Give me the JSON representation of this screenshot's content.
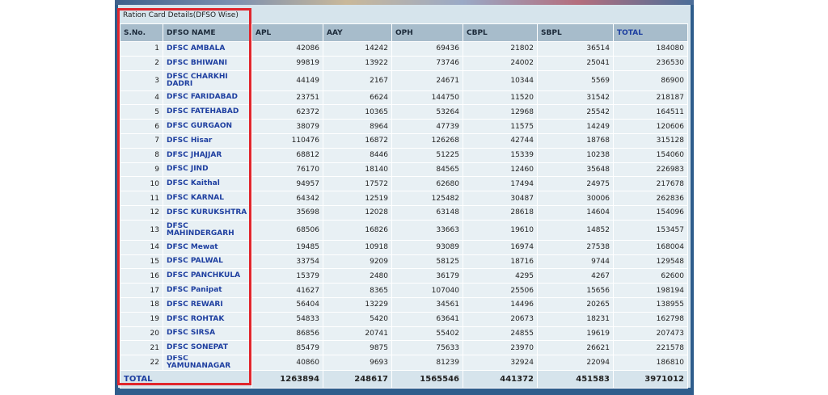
{
  "caption": "Ration Card Details(DFSO Wise)",
  "headers": [
    "S.No.",
    "DFSO NAME",
    "APL",
    "AAY",
    "OPH",
    "CBPL",
    "SBPL",
    "TOTAL"
  ],
  "rows": [
    {
      "sno": "1",
      "name": "DFSC AMBALA",
      "apl": "42086",
      "aay": "14242",
      "oph": "69436",
      "cbpl": "21802",
      "sbpl": "36514",
      "total": "184080"
    },
    {
      "sno": "2",
      "name": "DFSC BHIWANI",
      "apl": "99819",
      "aay": "13922",
      "oph": "73746",
      "cbpl": "24002",
      "sbpl": "25041",
      "total": "236530"
    },
    {
      "sno": "3",
      "name": "DFSC CHARKHI DADRI",
      "apl": "44149",
      "aay": "2167",
      "oph": "24671",
      "cbpl": "10344",
      "sbpl": "5569",
      "total": "86900"
    },
    {
      "sno": "4",
      "name": "DFSC FARIDABAD",
      "apl": "23751",
      "aay": "6624",
      "oph": "144750",
      "cbpl": "11520",
      "sbpl": "31542",
      "total": "218187"
    },
    {
      "sno": "5",
      "name": "DFSC FATEHABAD",
      "apl": "62372",
      "aay": "10365",
      "oph": "53264",
      "cbpl": "12968",
      "sbpl": "25542",
      "total": "164511"
    },
    {
      "sno": "6",
      "name": "DFSC GURGAON",
      "apl": "38079",
      "aay": "8964",
      "oph": "47739",
      "cbpl": "11575",
      "sbpl": "14249",
      "total": "120606"
    },
    {
      "sno": "7",
      "name": "DFSC Hisar",
      "apl": "110476",
      "aay": "16872",
      "oph": "126268",
      "cbpl": "42744",
      "sbpl": "18768",
      "total": "315128"
    },
    {
      "sno": "8",
      "name": "DFSC JHAJJAR",
      "apl": "68812",
      "aay": "8446",
      "oph": "51225",
      "cbpl": "15339",
      "sbpl": "10238",
      "total": "154060"
    },
    {
      "sno": "9",
      "name": "DFSC JIND",
      "apl": "76170",
      "aay": "18140",
      "oph": "84565",
      "cbpl": "12460",
      "sbpl": "35648",
      "total": "226983"
    },
    {
      "sno": "10",
      "name": "DFSC Kaithal",
      "apl": "94957",
      "aay": "17572",
      "oph": "62680",
      "cbpl": "17494",
      "sbpl": "24975",
      "total": "217678"
    },
    {
      "sno": "11",
      "name": "DFSC KARNAL",
      "apl": "64342",
      "aay": "12519",
      "oph": "125482",
      "cbpl": "30487",
      "sbpl": "30006",
      "total": "262836"
    },
    {
      "sno": "12",
      "name": "DFSC KURUKSHTRA",
      "apl": "35698",
      "aay": "12028",
      "oph": "63148",
      "cbpl": "28618",
      "sbpl": "14604",
      "total": "154096"
    },
    {
      "sno": "13",
      "name": "DFSC MAHINDERGARH",
      "apl": "68506",
      "aay": "16826",
      "oph": "33663",
      "cbpl": "19610",
      "sbpl": "14852",
      "total": "153457"
    },
    {
      "sno": "14",
      "name": "DFSC Mewat",
      "apl": "19485",
      "aay": "10918",
      "oph": "93089",
      "cbpl": "16974",
      "sbpl": "27538",
      "total": "168004"
    },
    {
      "sno": "15",
      "name": "DFSC PALWAL",
      "apl": "33754",
      "aay": "9209",
      "oph": "58125",
      "cbpl": "18716",
      "sbpl": "9744",
      "total": "129548"
    },
    {
      "sno": "16",
      "name": "DFSC PANCHKULA",
      "apl": "15379",
      "aay": "2480",
      "oph": "36179",
      "cbpl": "4295",
      "sbpl": "4267",
      "total": "62600"
    },
    {
      "sno": "17",
      "name": "DFSC Panipat",
      "apl": "41627",
      "aay": "8365",
      "oph": "107040",
      "cbpl": "25506",
      "sbpl": "15656",
      "total": "198194"
    },
    {
      "sno": "18",
      "name": "DFSC REWARI",
      "apl": "56404",
      "aay": "13229",
      "oph": "34561",
      "cbpl": "14496",
      "sbpl": "20265",
      "total": "138955"
    },
    {
      "sno": "19",
      "name": "DFSC ROHTAK",
      "apl": "54833",
      "aay": "5420",
      "oph": "63641",
      "cbpl": "20673",
      "sbpl": "18231",
      "total": "162798"
    },
    {
      "sno": "20",
      "name": "DFSC SIRSA",
      "apl": "86856",
      "aay": "20741",
      "oph": "55402",
      "cbpl": "24855",
      "sbpl": "19619",
      "total": "207473"
    },
    {
      "sno": "21",
      "name": "DFSC SONEPAT",
      "apl": "85479",
      "aay": "9875",
      "oph": "75633",
      "cbpl": "23970",
      "sbpl": "26621",
      "total": "221578"
    },
    {
      "sno": "22",
      "name": "DFSC YAMUNANAGAR",
      "apl": "40860",
      "aay": "9693",
      "oph": "81239",
      "cbpl": "32924",
      "sbpl": "22094",
      "total": "186810"
    }
  ],
  "totals": {
    "label": "TOTAL",
    "apl": "1263894",
    "aay": "248617",
    "oph": "1565546",
    "cbpl": "441372",
    "sbpl": "451583",
    "total": "3971012"
  },
  "colors": {
    "highlight": "#e0262d",
    "header_bg": "#a7bccb",
    "link": "#1e3fa0"
  }
}
